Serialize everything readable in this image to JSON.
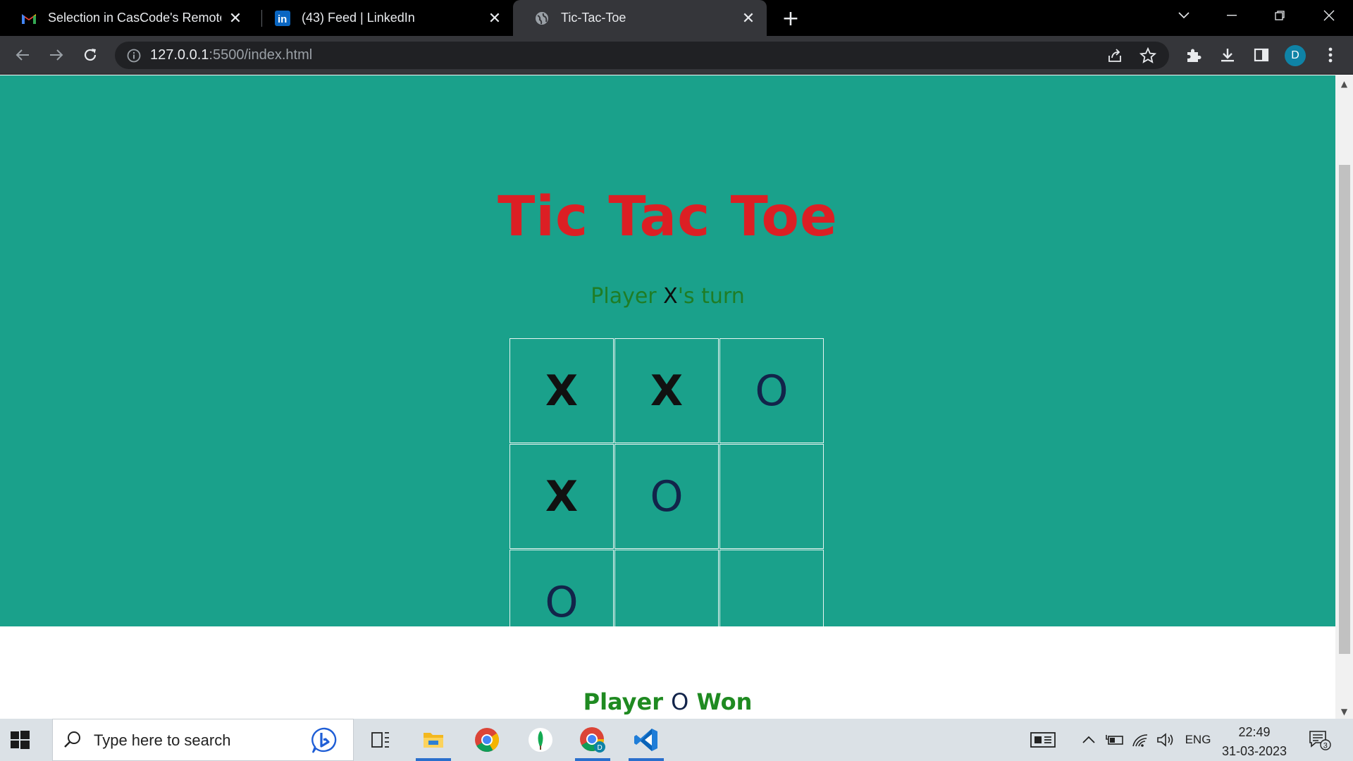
{
  "browser": {
    "tabs": [
      {
        "title": "Selection in CasCode's Remote In",
        "icon": "gmail-icon",
        "active": false
      },
      {
        "title": "(43) Feed | LinkedIn",
        "icon": "linkedin-icon",
        "active": false
      },
      {
        "title": "Tic-Tac-Toe",
        "icon": "globe-icon",
        "active": true
      }
    ],
    "new_tab_label": "+",
    "url_host": "127.0.0.1",
    "url_rest": ":5500/index.html",
    "profile_initial": "D"
  },
  "page": {
    "title": "Tic Tac Toe",
    "turn": {
      "prefix": "Player ",
      "player": "X",
      "suffix": "'s turn"
    },
    "board": [
      "X",
      "X",
      "O",
      "X",
      "O",
      "",
      "O",
      "",
      ""
    ],
    "winner": {
      "prefix": "Player ",
      "player": "O",
      "suffix": " Won"
    },
    "colors": {
      "background": "#1aa18b",
      "title": "#dc1f24",
      "turn_text": "#1f7d26",
      "o_mark": "#12244a"
    }
  },
  "taskbar": {
    "search_placeholder": "Type here to search",
    "language": "ENG",
    "time": "22:49",
    "date": "31-03-2023",
    "notification_count": "3",
    "pinned": [
      "task-view-icon",
      "file-explorer-icon",
      "chrome-icon",
      "mongodb-compass-icon",
      "chrome-profile-icon",
      "vscode-icon"
    ]
  }
}
